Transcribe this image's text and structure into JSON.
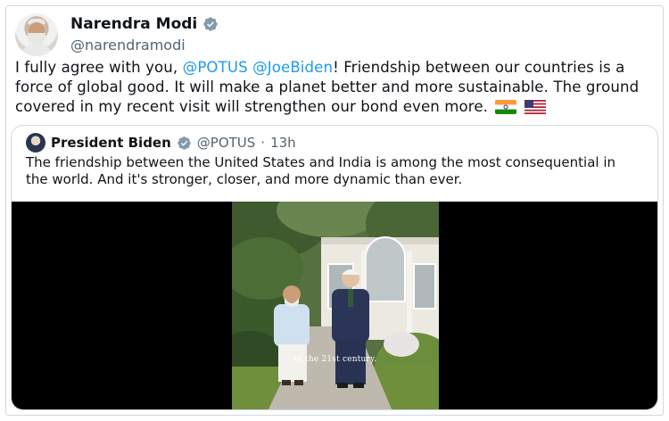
{
  "tweet": {
    "author_name": "Narendra Modi",
    "author_handle": "@narendramodi",
    "text_prefix": "I fully agree with you, ",
    "mention_potus": "@POTUS",
    "mention_joebiden": "@JoeBiden",
    "text_body": "! Friendship between our countries is a force of global good. It will make a planet better and more sustainable. The ground covered in my recent visit will strengthen our bond even more.",
    "flags": [
      "india-flag-icon",
      "usa-flag-icon"
    ]
  },
  "quoted": {
    "author_name": "President Biden",
    "author_handle": "@POTUS",
    "separator": "·",
    "timestamp": "13h",
    "text": "The friendship between the United States and India is among the most consequential in the world. And it's stronger, closer, and more dynamic than ever.",
    "media_caption": "of the 21st century."
  },
  "colors": {
    "accent": "#1d9bf0",
    "text": "#0f1419",
    "muted": "#536471",
    "border": "#cfd9de"
  }
}
